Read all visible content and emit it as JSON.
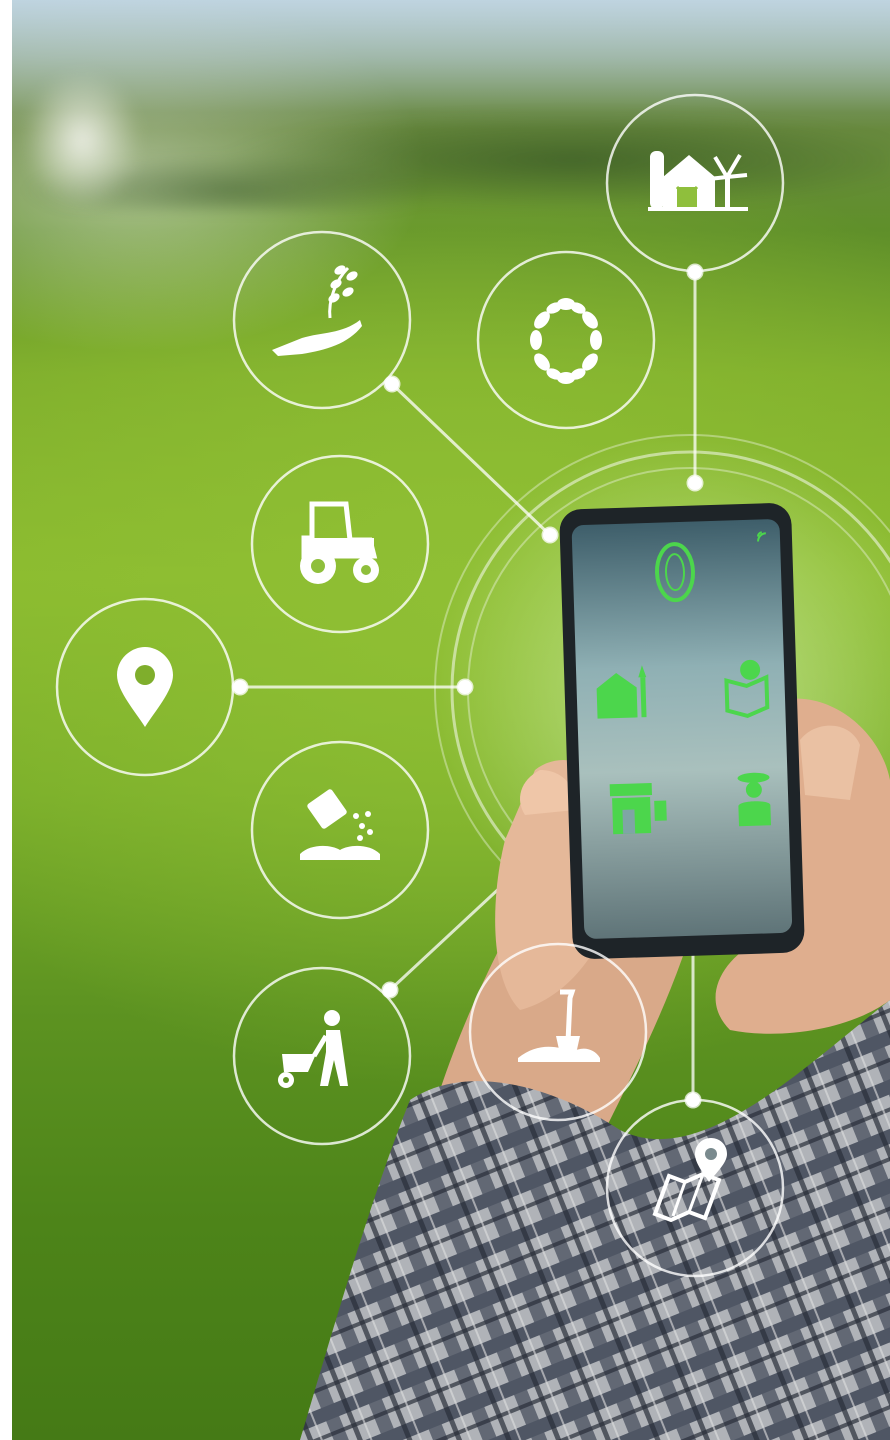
{
  "image": {
    "subject": "smart-farming-phone-concept",
    "palette": {
      "grass_light": "#8cbc2f",
      "grass_dark": "#457a16",
      "sky": "#b9cfe0",
      "icon_white": "#ffffff",
      "screen_green": "#4cd64c",
      "phone_body": "#1e2428",
      "skin": "#e3b79a",
      "shirt_plaid": "#4a5260"
    },
    "icons": [
      "farm-barn-windmill-icon",
      "hand-seedling-icon",
      "leaf-wreath-icon",
      "tractor-icon",
      "location-pin-icon",
      "fertilizer-soil-icon",
      "farmer-wheelbarrow-icon",
      "shovel-soil-icon",
      "map-pin-icon"
    ],
    "phone_screen_icons": [
      "leaf-wreath-icon",
      "farm-barn-icon",
      "map-pin-icon",
      "market-stall-icon",
      "farmer-icon",
      "wifi-icon"
    ]
  }
}
